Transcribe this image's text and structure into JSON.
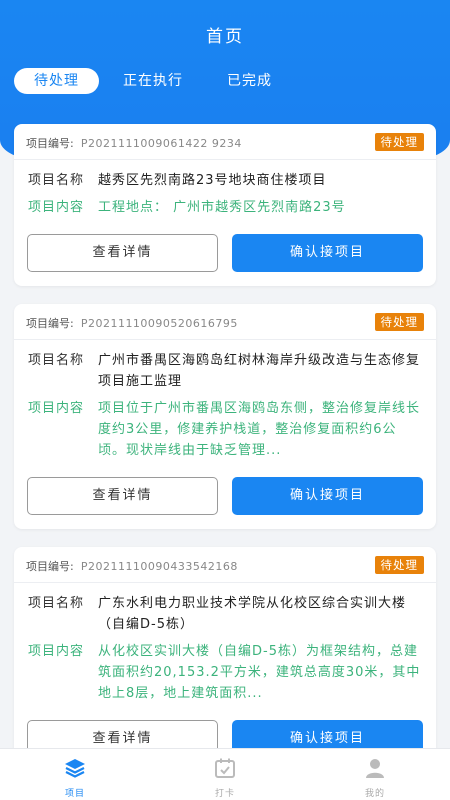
{
  "header": {
    "title": "首页"
  },
  "tabs": [
    {
      "label": "待处理",
      "active": true
    },
    {
      "label": "正在执行",
      "active": false
    },
    {
      "label": "已完成",
      "active": false
    }
  ],
  "cards": [
    {
      "code_label": "项目编号:",
      "code": "P2021111009061422 9234",
      "status": "待处理",
      "name_label": "项目名称",
      "name": "越秀区先烈南路23号地块商住楼项目",
      "content_label": "项目内容",
      "content": "工程地点： 广州市越秀区先烈南路23号",
      "detail_button": "查看详情",
      "confirm_button": "确认接项目"
    },
    {
      "code_label": "项目编号:",
      "code": "P20211110090520616795",
      "status": "待处理",
      "name_label": "项目名称",
      "name": "广州市番禺区海鸥岛红树林海岸升级改造与生态修复项目施工监理",
      "content_label": "项目内容",
      "content": "项目位于广州市番禺区海鸥岛东侧，整治修复岸线长度约3公里，修建养护栈道，整治修复面积约6公顷。现状岸线由于缺乏管理...",
      "detail_button": "查看详情",
      "confirm_button": "确认接项目"
    },
    {
      "code_label": "项目编号:",
      "code": "P20211110090433542168",
      "status": "待处理",
      "name_label": "项目名称",
      "name": "广东水利电力职业技术学院从化校区综合实训大楼（自编D-5栋）",
      "content_label": "项目内容",
      "content": "从化校区实训大楼（自编D-5栋）为框架结构，总建筑面积约20,153.2平方米，建筑总高度30米，其中地上8层，地上建筑面积...",
      "detail_button": "查看详情",
      "confirm_button": "确认接项目"
    }
  ],
  "tabbar": [
    {
      "label": "项目",
      "icon": "layers-icon",
      "active": true
    },
    {
      "label": "打卡",
      "icon": "calendar-check-icon",
      "active": false
    },
    {
      "label": "我的",
      "icon": "user-icon",
      "active": false
    }
  ],
  "colors": {
    "primary": "#1a86f2",
    "badge": "#e8820a",
    "green": "#3cb37c"
  }
}
